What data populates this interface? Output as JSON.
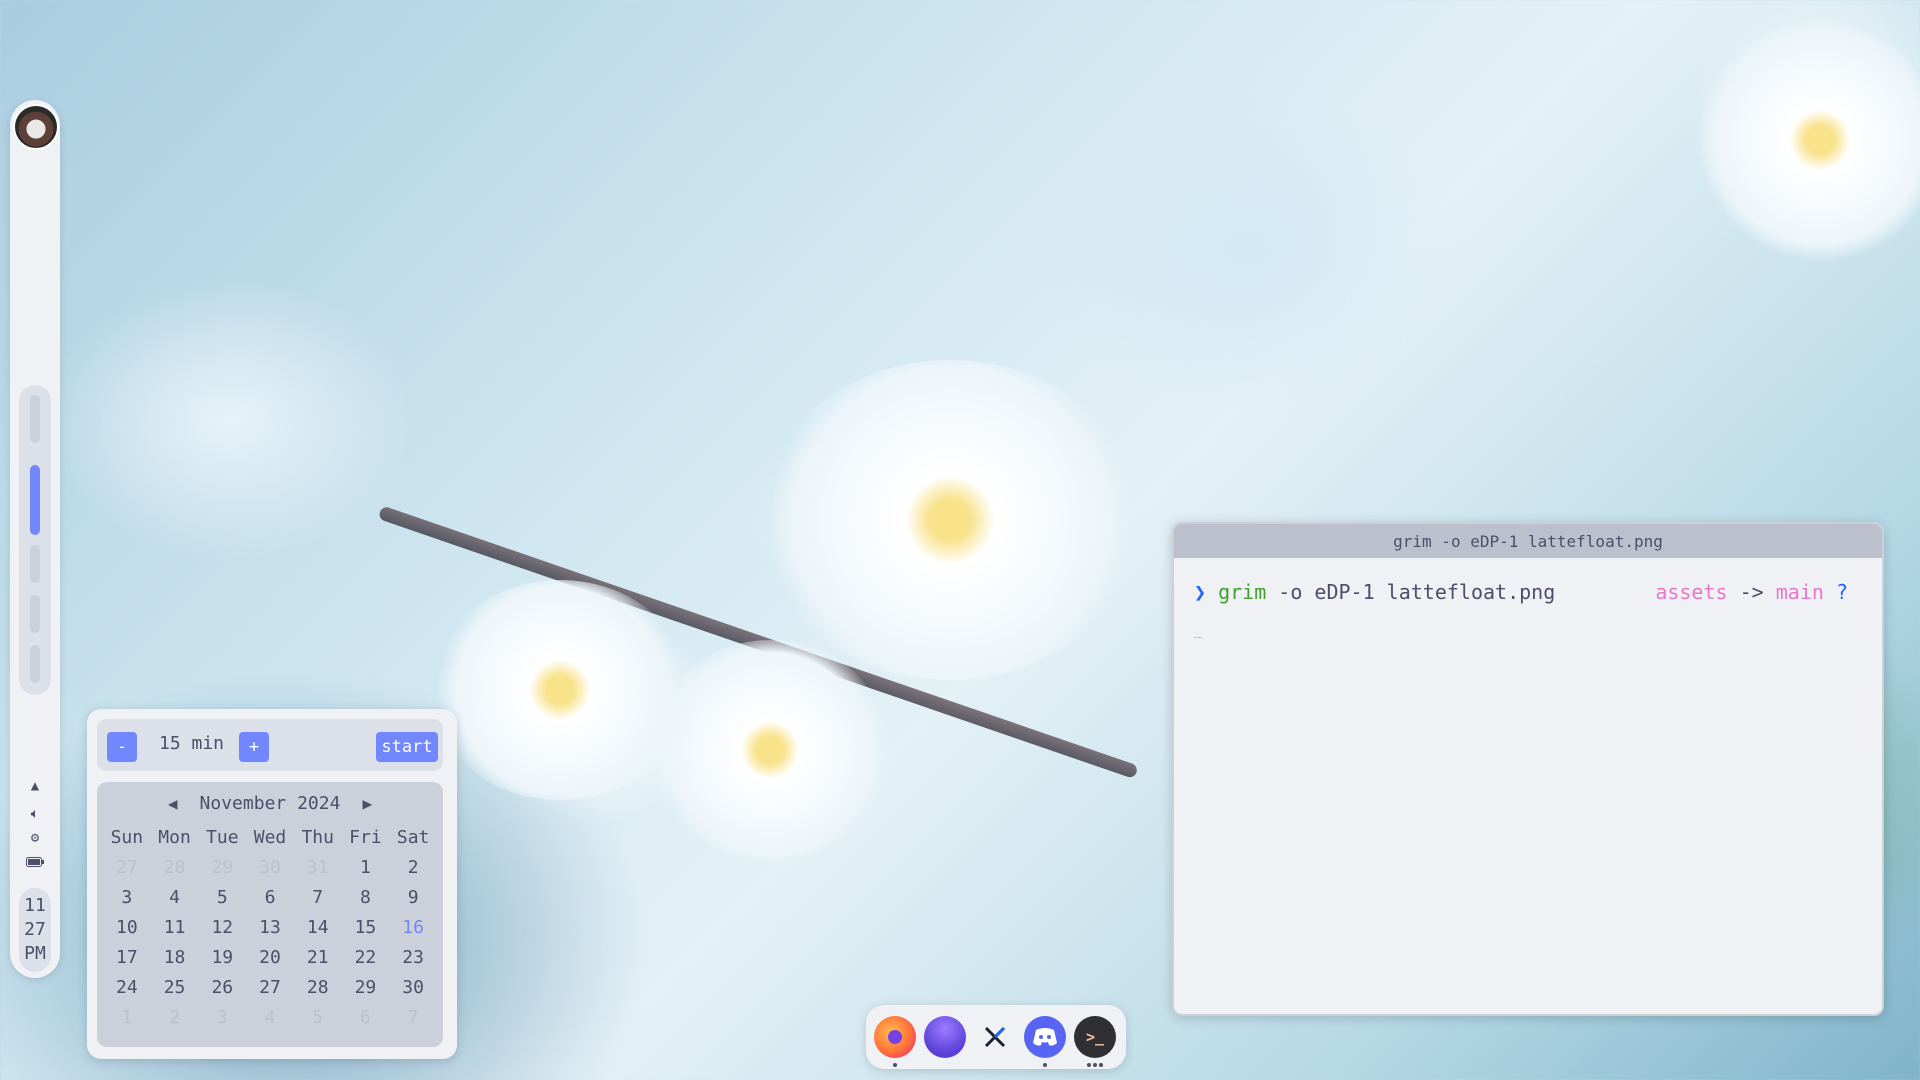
{
  "calendar": {
    "month_label": "November 2024",
    "weekdays": [
      "Sun",
      "Mon",
      "Tue",
      "Wed",
      "Thu",
      "Fri",
      "Sat"
    ],
    "weeks": [
      [
        {
          "d": "27",
          "dim": true
        },
        {
          "d": "28",
          "dim": true
        },
        {
          "d": "29",
          "dim": true
        },
        {
          "d": "30",
          "dim": true
        },
        {
          "d": "31",
          "dim": true
        },
        {
          "d": "1"
        },
        {
          "d": "2"
        }
      ],
      [
        {
          "d": "3"
        },
        {
          "d": "4"
        },
        {
          "d": "5"
        },
        {
          "d": "6"
        },
        {
          "d": "7"
        },
        {
          "d": "8"
        },
        {
          "d": "9"
        }
      ],
      [
        {
          "d": "10"
        },
        {
          "d": "11"
        },
        {
          "d": "12"
        },
        {
          "d": "13"
        },
        {
          "d": "14"
        },
        {
          "d": "15"
        },
        {
          "d": "16",
          "today": true
        }
      ],
      [
        {
          "d": "17"
        },
        {
          "d": "18"
        },
        {
          "d": "19"
        },
        {
          "d": "20"
        },
        {
          "d": "21"
        },
        {
          "d": "22"
        },
        {
          "d": "23"
        }
      ],
      [
        {
          "d": "24"
        },
        {
          "d": "25"
        },
        {
          "d": "26"
        },
        {
          "d": "27"
        },
        {
          "d": "28"
        },
        {
          "d": "29"
        },
        {
          "d": "30"
        }
      ],
      [
        {
          "d": "1",
          "dim": true
        },
        {
          "d": "2",
          "dim": true
        },
        {
          "d": "3",
          "dim": true
        },
        {
          "d": "4",
          "dim": true
        },
        {
          "d": "5",
          "dim": true
        },
        {
          "d": "6",
          "dim": true
        },
        {
          "d": "7",
          "dim": true
        }
      ]
    ]
  },
  "timer": {
    "minus_label": "-",
    "plus_label": "+",
    "value_label": "15 min",
    "start_label": "start"
  },
  "clock": {
    "hour": "11",
    "minute": "27",
    "period": "PM"
  },
  "terminal": {
    "title": "grim -o eDP-1 lattefloat.png",
    "prompt_symbol": "❯",
    "command": "grim",
    "args": " -o eDP-1 lattefloat.png",
    "dir": "assets",
    "arrow": " -> ",
    "branch": "main",
    "status": " ?",
    "cursor": "_"
  },
  "dock": {
    "apps": [
      "firefox-icon",
      "app-icon",
      "code-icon",
      "discord-icon",
      "terminal-icon"
    ],
    "terminal_glyph": ">_"
  },
  "colors": {
    "accent": "#7287fd",
    "base": "#eff1f5",
    "text": "#4c4f69"
  }
}
